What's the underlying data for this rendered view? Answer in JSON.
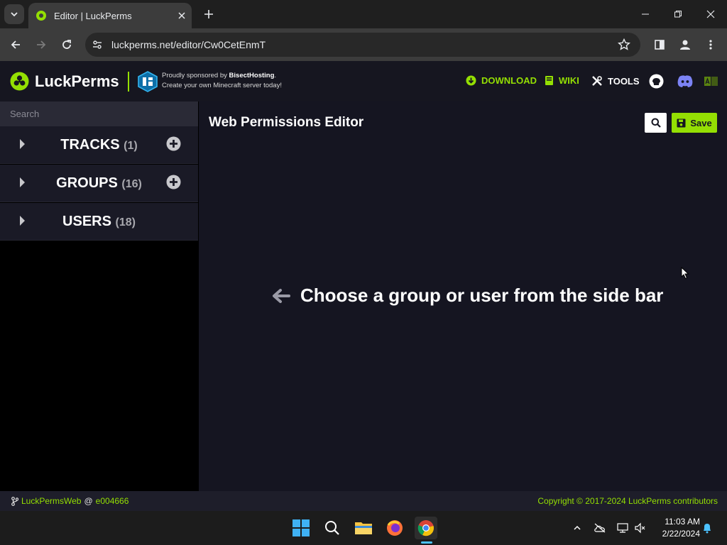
{
  "browser": {
    "tab_title": "Editor | LuckPerms",
    "url": "luckperms.net/editor/Cw0CetEnmT"
  },
  "header": {
    "logo_text": "LuckPerms",
    "sponsor_line1_prefix": "Proudly sponsored by ",
    "sponsor_name": "BisectHosting",
    "sponsor_line1_suffix": ".",
    "sponsor_line2": "Create your own Minecraft server today!",
    "nav": {
      "download": "DOWNLOAD",
      "wiki": "WIKI",
      "tools": "TOOLS"
    }
  },
  "sidebar": {
    "search_placeholder": "Search",
    "items": [
      {
        "label": "TRACKS",
        "count": "(1)"
      },
      {
        "label": "GROUPS",
        "count": "(16)"
      },
      {
        "label": "USERS",
        "count": "(18)"
      }
    ]
  },
  "main": {
    "title": "Web Permissions Editor",
    "save_label": "Save",
    "empty_message": "Choose a group or user from the side bar"
  },
  "footer": {
    "project": "LuckPermsWeb",
    "at": "@",
    "commit": "e004666",
    "copyright": "Copyright © 2017-2024 LuckPerms contributors"
  },
  "taskbar": {
    "time": "11:03 AM",
    "date": "2/22/2024"
  },
  "colors": {
    "accent": "#94df03",
    "page_bg": "#151521",
    "header_bg": "#161620"
  }
}
